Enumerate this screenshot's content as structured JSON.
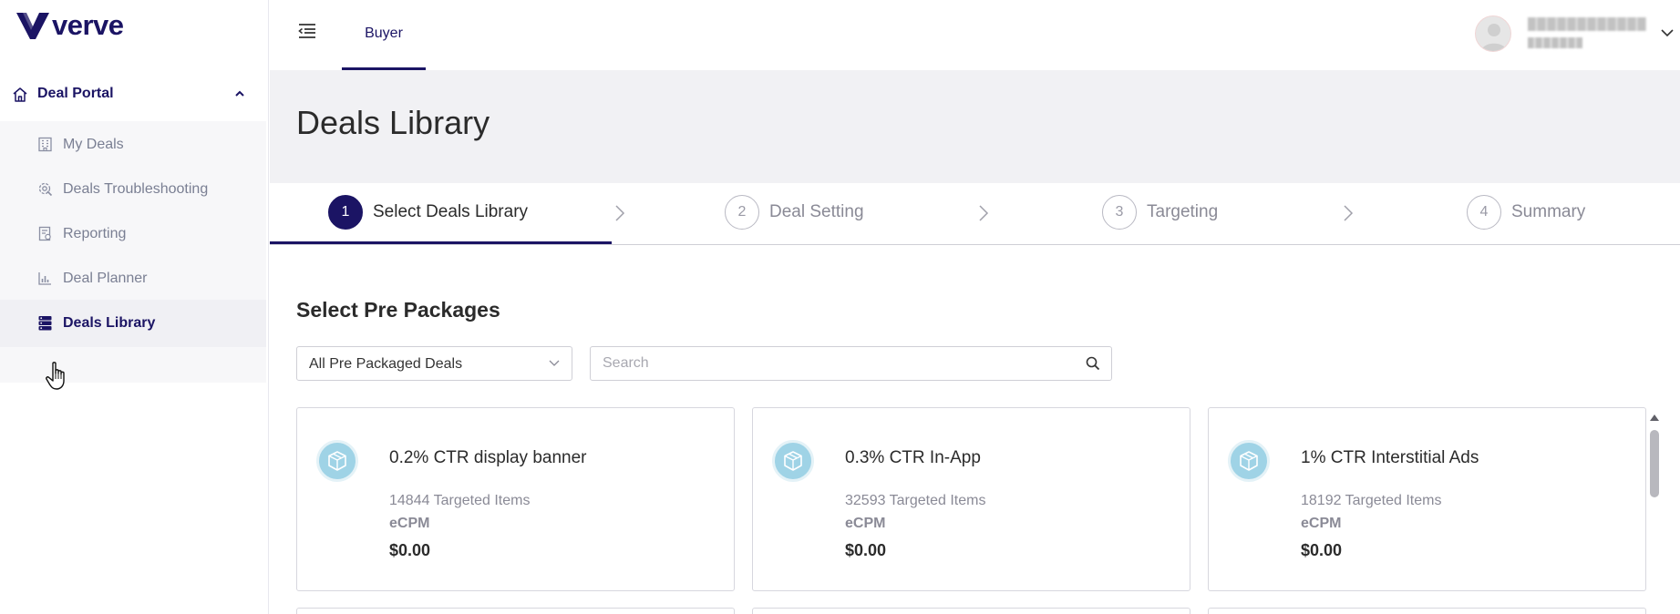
{
  "brand": {
    "name": "verve",
    "color": "#1b1464"
  },
  "sidebar": {
    "group_label": "Deal Portal",
    "items": [
      {
        "label": "My Deals",
        "icon": "building-icon",
        "active": false
      },
      {
        "label": "Deals Troubleshooting",
        "icon": "gear-wrench-icon",
        "active": false
      },
      {
        "label": "Reporting",
        "icon": "report-icon",
        "active": false
      },
      {
        "label": "Deal Planner",
        "icon": "bar-chart-icon",
        "active": false
      },
      {
        "label": "Deals Library",
        "icon": "server-icon",
        "active": true
      }
    ]
  },
  "topbar": {
    "tab_label": "Buyer"
  },
  "page": {
    "title": "Deals Library"
  },
  "stepper": {
    "steps": [
      {
        "number": "1",
        "label": "Select Deals Library",
        "active": true
      },
      {
        "number": "2",
        "label": "Deal Setting",
        "active": false
      },
      {
        "number": "3",
        "label": "Targeting",
        "active": false
      },
      {
        "number": "4",
        "label": "Summary",
        "active": false
      }
    ]
  },
  "section": {
    "title": "Select Pre Packages",
    "filter_value": "All Pre Packaged Deals",
    "search_placeholder": "Search"
  },
  "cards": [
    {
      "title": "0.2% CTR display banner",
      "items": "14844 Targeted Items",
      "metric": "eCPM",
      "price": "$0.00",
      "icon": "package-icon"
    },
    {
      "title": "0.3% CTR In-App",
      "items": "32593 Targeted Items",
      "metric": "eCPM",
      "price": "$0.00",
      "icon": "package-icon"
    },
    {
      "title": "1% CTR Interstitial Ads",
      "items": "18192 Targeted Items",
      "metric": "eCPM",
      "price": "$0.00",
      "icon": "package-icon"
    }
  ]
}
